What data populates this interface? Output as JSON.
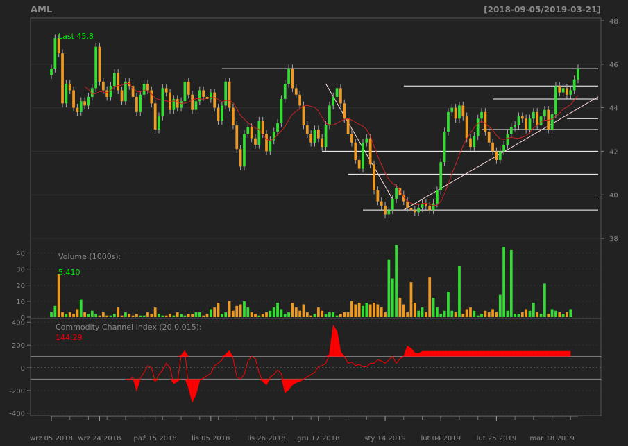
{
  "header": {
    "symbol": "AML",
    "date_range": "[2018-09-05/2019-03-21]"
  },
  "price_panel": {
    "last_label": "Last 45.8"
  },
  "volume_panel": {
    "label": "Volume (1000s):",
    "last_value": "5.410"
  },
  "cci_panel": {
    "label": "Commodity Channel Index (20,0.015):",
    "last_value": "144.29"
  },
  "colors": {
    "background": "#222222",
    "up": "#33dd33",
    "down": "#ee9922",
    "ma": "#cc2222",
    "cci": "#ff0000",
    "last_text": "#00ee00",
    "axis_text": "#888888"
  },
  "chart_data": {
    "type": "candlestick",
    "price_axis": {
      "ticks": [
        38,
        40,
        42,
        44,
        46,
        48
      ],
      "ylim": [
        38,
        48
      ]
    },
    "volume_axis": {
      "ticks": [
        0,
        10,
        20,
        30,
        40
      ],
      "ylim": [
        0,
        48
      ]
    },
    "cci_axis": {
      "ticks": [
        -400,
        -200,
        0,
        200,
        400
      ],
      "ylim": [
        -420,
        420
      ],
      "bands": [
        100,
        -100
      ]
    },
    "x_tick_labels": [
      "wrz 05 2018",
      "wrz 24 2018",
      "paź 15 2018",
      "lis 05 2018",
      "lis 26 2018",
      "gru 17 2018",
      "sty 14 2019",
      "lut 04 2019",
      "lut 25 2019",
      "mar 18 2019"
    ],
    "x_tick_indices": [
      0,
      13,
      28,
      43,
      58,
      72,
      90,
      105,
      120,
      135
    ],
    "close": [
      45.8,
      47.2,
      46.5,
      44.2,
      45.1,
      44.8,
      44.0,
      43.8,
      44.3,
      44.1,
      44.5,
      44.9,
      46.8,
      45.2,
      44.8,
      44.5,
      45.0,
      45.6,
      44.8,
      44.3,
      45.2,
      45.0,
      44.5,
      43.8,
      44.6,
      45.1,
      44.8,
      44.2,
      43.0,
      43.6,
      44.9,
      44.7,
      43.9,
      44.4,
      44.0,
      44.3,
      45.2,
      44.6,
      43.9,
      44.3,
      44.8,
      44.5,
      44.4,
      44.7,
      44.0,
      43.4,
      44.1,
      45.2,
      44.0,
      43.2,
      42.1,
      41.3,
      42.8,
      43.1,
      42.6,
      42.3,
      43.4,
      42.8,
      42.0,
      42.5,
      42.9,
      43.3,
      44.4,
      45.1,
      45.8,
      44.9,
      44.6,
      44.1,
      43.2,
      42.8,
      42.4,
      43.0,
      42.6,
      42.2,
      43.2,
      44.1,
      44.5,
      44.9,
      44.2,
      43.5,
      42.8,
      42.4,
      41.6,
      41.2,
      42.4,
      42.6,
      41.4,
      40.2,
      39.7,
      39.5,
      39.1,
      39.3,
      39.8,
      40.3,
      40.0,
      39.7,
      39.4,
      39.3,
      39.2,
      39.4,
      39.6,
      39.5,
      39.3,
      39.6,
      40.2,
      41.5,
      42.9,
      43.8,
      44.0,
      43.5,
      44.1,
      43.6,
      42.6,
      42.2,
      42.7,
      43.5,
      43.8,
      42.9,
      42.4,
      42.0,
      41.6,
      42.0,
      42.3,
      42.8,
      43.1,
      43.2,
      43.6,
      43.5,
      43.0,
      43.5,
      43.8,
      43.2,
      43.6,
      43.9,
      43.0,
      43.7,
      45.0,
      44.7,
      44.9,
      44.6,
      44.8,
      45.3,
      45.8
    ],
    "open": [
      45.5,
      45.8,
      47.2,
      46.5,
      44.2,
      45.1,
      44.8,
      44.0,
      43.8,
      44.3,
      44.1,
      44.5,
      44.9,
      46.8,
      45.2,
      44.8,
      44.5,
      45.0,
      45.6,
      44.8,
      44.3,
      45.2,
      45.0,
      44.5,
      43.8,
      44.6,
      45.1,
      44.8,
      44.2,
      43.0,
      43.6,
      44.9,
      44.7,
      43.9,
      44.4,
      44.0,
      44.3,
      45.2,
      44.6,
      43.9,
      44.3,
      44.8,
      44.5,
      44.4,
      44.7,
      44.0,
      43.4,
      44.1,
      45.2,
      44.0,
      43.2,
      42.1,
      41.3,
      42.8,
      43.1,
      42.6,
      42.3,
      43.4,
      42.8,
      42.0,
      42.5,
      42.9,
      43.3,
      44.4,
      45.1,
      45.8,
      44.9,
      44.6,
      44.1,
      43.2,
      42.8,
      42.4,
      43.0,
      42.6,
      42.2,
      43.2,
      44.1,
      44.5,
      44.9,
      44.2,
      43.5,
      42.8,
      42.4,
      41.6,
      41.2,
      42.4,
      42.6,
      41.4,
      40.2,
      39.7,
      39.5,
      39.1,
      39.3,
      39.8,
      40.3,
      40.0,
      39.7,
      39.4,
      39.3,
      39.2,
      39.4,
      39.6,
      39.5,
      39.3,
      39.6,
      40.2,
      41.5,
      42.9,
      43.8,
      44.0,
      43.5,
      44.1,
      43.6,
      42.6,
      42.2,
      42.7,
      43.5,
      43.8,
      42.9,
      42.4,
      42.0,
      41.6,
      42.0,
      42.3,
      42.8,
      43.1,
      43.2,
      43.6,
      43.5,
      43.0,
      43.5,
      43.8,
      43.2,
      43.6,
      43.9,
      43.0,
      43.7,
      45.0,
      44.7,
      44.9,
      44.6,
      44.8,
      45.3
    ],
    "volume": [
      3,
      7,
      27,
      3,
      2,
      3,
      2,
      5,
      11,
      3,
      2,
      4,
      2,
      1,
      3,
      1,
      1,
      2,
      6,
      1,
      3,
      2,
      1,
      2,
      1,
      1,
      3,
      2,
      6,
      2,
      1,
      1,
      2,
      1,
      3,
      2,
      1,
      2,
      2,
      3,
      3,
      1,
      2,
      5,
      6,
      9,
      2,
      3,
      10,
      4,
      7,
      8,
      10,
      6,
      3,
      2,
      1,
      2,
      3,
      4,
      6,
      9,
      5,
      2,
      3,
      9,
      6,
      4,
      8,
      3,
      1,
      2,
      6,
      4,
      2,
      3,
      3,
      1,
      2,
      3,
      3,
      10,
      8,
      9,
      7,
      9,
      8,
      9,
      8,
      6,
      3,
      36,
      24,
      45,
      12,
      8,
      3,
      22,
      9,
      4,
      6,
      3,
      25,
      12,
      6,
      2,
      4,
      16,
      4,
      3,
      32,
      2,
      5,
      6,
      4,
      1,
      2,
      4,
      3,
      5,
      3,
      14,
      44,
      4,
      42,
      2,
      2,
      3,
      5,
      4,
      9,
      3,
      2,
      21,
      2,
      5,
      4,
      3,
      2,
      3,
      5
    ],
    "cci": [
      null,
      null,
      null,
      null,
      null,
      null,
      null,
      null,
      null,
      null,
      null,
      null,
      null,
      null,
      null,
      null,
      null,
      null,
      null,
      null,
      -100,
      -110,
      -80,
      -200,
      -90,
      -40,
      20,
      0,
      -120,
      -60,
      -20,
      40,
      0,
      -140,
      -120,
      110,
      150,
      -180,
      -300,
      -230,
      -110,
      -90,
      -70,
      -50,
      20,
      40,
      70,
      120,
      150,
      80,
      -80,
      -100,
      -60,
      60,
      100,
      80,
      -40,
      -120,
      -150,
      -80,
      -60,
      -20,
      -50,
      -220,
      -190,
      -150,
      -130,
      -120,
      -100,
      -80,
      -60,
      -40,
      10,
      20,
      40,
      120,
      370,
      320,
      140,
      100,
      40,
      50,
      20,
      30,
      10,
      10,
      40,
      40,
      70,
      60,
      40,
      70,
      100,
      40,
      80,
      100,
      190,
      170,
      130,
      125,
      144,
      144,
      144,
      144,
      144,
      144,
      144,
      144,
      144,
      144,
      144,
      144,
      144,
      144,
      144,
      144,
      144,
      144,
      144,
      144,
      144,
      144,
      144,
      144,
      144,
      144,
      144,
      144,
      144,
      144,
      144,
      144,
      144,
      144,
      144,
      144,
      144,
      144,
      144,
      144,
      144
    ]
  }
}
